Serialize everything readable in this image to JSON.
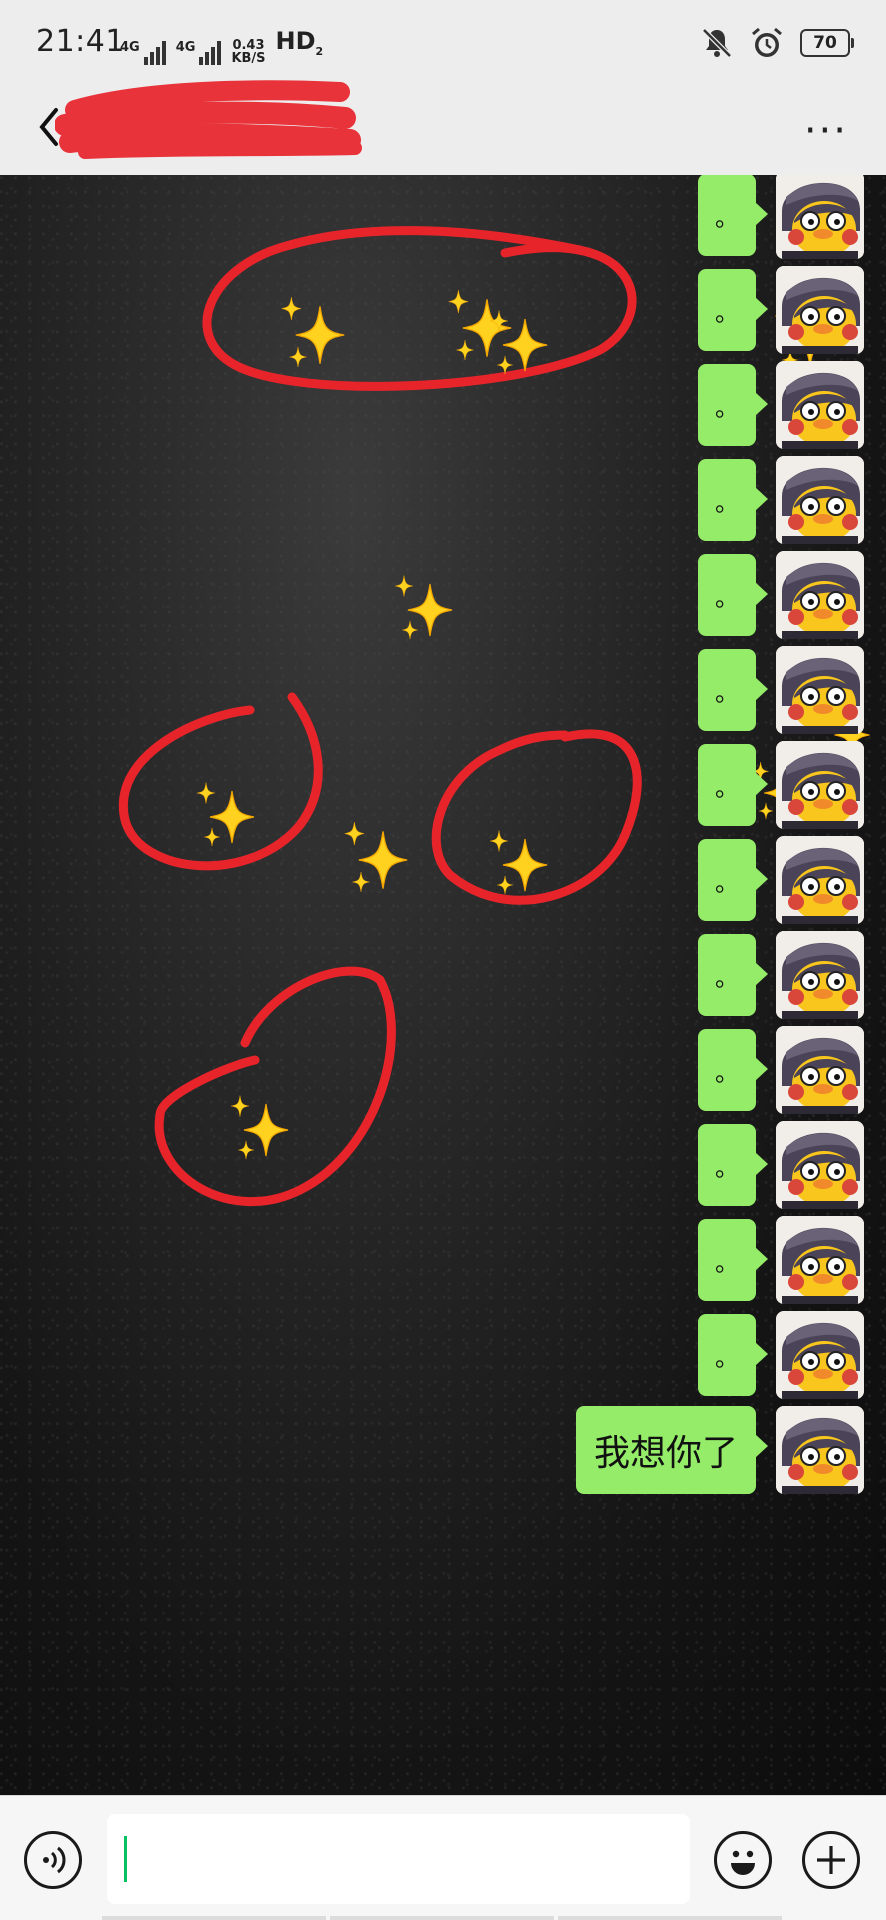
{
  "status_bar": {
    "time": "21:41",
    "signal_1": "4G",
    "signal_2": "4G",
    "speed_value": "0.43",
    "speed_unit": "KB/S",
    "hd_label": "HD",
    "hd_sub": "2",
    "battery": "70",
    "icons": [
      "mute-bell-icon",
      "alarm-icon",
      "battery-icon"
    ]
  },
  "header": {
    "back_icon": "chevron-left-icon",
    "title": "",
    "more_icon": "more-dots-icon",
    "more_label": "···"
  },
  "messages": [
    {
      "text": "。",
      "sender": "self"
    },
    {
      "text": "。",
      "sender": "self"
    },
    {
      "text": "。",
      "sender": "self"
    },
    {
      "text": "。",
      "sender": "self"
    },
    {
      "text": "。",
      "sender": "self"
    },
    {
      "text": "。",
      "sender": "self"
    },
    {
      "text": "。",
      "sender": "self"
    },
    {
      "text": "。",
      "sender": "self"
    },
    {
      "text": "。",
      "sender": "self"
    },
    {
      "text": "。",
      "sender": "self"
    },
    {
      "text": "。",
      "sender": "self"
    },
    {
      "text": "。",
      "sender": "self"
    },
    {
      "text": "。",
      "sender": "self"
    },
    {
      "text": "我想你了",
      "sender": "self"
    }
  ],
  "composer": {
    "value": "",
    "voice_icon": "voice-icon",
    "emoji_icon": "emoji-icon",
    "plus_icon": "plus-icon"
  },
  "colors": {
    "bubble_self": "#95ec69",
    "header_bg": "#ededed",
    "annotation": "#e8242b",
    "sparkle": "#ffd21f",
    "caret": "#07c160"
  }
}
